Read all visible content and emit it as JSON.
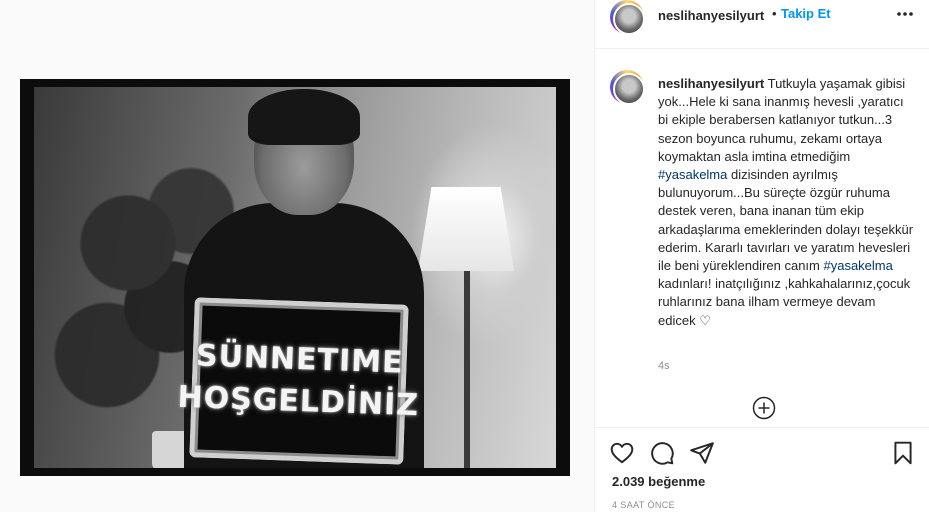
{
  "post": {
    "sign_line_1": "SÜNNETIME",
    "sign_line_2": "HOŞGELDİNİZ"
  },
  "header": {
    "username": "neslihanyesilyurt",
    "separator": "•",
    "follow_label": "Takip Et",
    "more_icon": "more-horizontal-icon"
  },
  "caption": {
    "username": "neslihanyesilyurt",
    "part_1": "Tutkuyla yaşamak gibisi yok...Hele ki sana inanmış hevesli ,yaratıcı bi ekiple berabersen katlanıyor tutkun...3 sezon boyunca ruhumu, zekamı ortaya koymaktan asla imtina etmediğim ",
    "hashtag_1": "#yasakelma",
    "part_2": " dizisinden ayrılmış bulunuyorum...Bu süreçte özgür ruhuma destek veren, bana inanan tüm ekip arkadaşlarıma emeklerinden dolayı teşekkür ederim. Kararlı tavırları ve yaratım hevesleri ile beni yüreklendiren canım ",
    "hashtag_2": "#yasakelma",
    "part_3": " kadınları! inatçılığınız ,kahkahalarınız,çocuk ruhlarınız bana ilham vermeye devam edicek ♡",
    "time": "4s",
    "load_more_icon": "plus-circle-icon"
  },
  "actions": {
    "icons": [
      "heart-icon",
      "comment-icon",
      "share-icon",
      "bookmark-icon"
    ],
    "likes": "2.039 beğenme",
    "post_age": "4 SAAT ÖNCE"
  }
}
